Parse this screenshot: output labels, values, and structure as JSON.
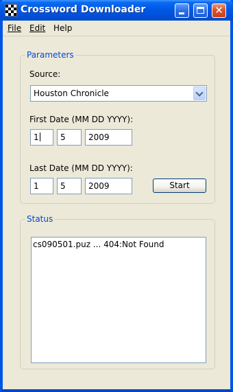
{
  "window": {
    "title": "Crossword Downloader"
  },
  "menu": {
    "file": "File",
    "edit": "Edit",
    "help": "Help"
  },
  "parameters": {
    "legend": "Parameters",
    "source_label": "Source:",
    "source_value": "Houston Chronicle",
    "first_date_label": "First Date (MM DD YYYY):",
    "first_date": {
      "month": "1",
      "day": "5",
      "year": "2009"
    },
    "last_date_label": "Last Date (MM DD YYYY):",
    "last_date": {
      "month": "1",
      "day": "5",
      "year": "2009"
    },
    "start_label": "Start"
  },
  "status": {
    "legend": "Status",
    "lines": [
      "cs090501.puz ... 404:Not Found"
    ]
  },
  "icons": {
    "app": "crossword-grid-icon",
    "minimize": "minimize-icon",
    "maximize": "maximize-icon",
    "close": "close-icon",
    "dropdown": "chevron-down-icon"
  },
  "colors": {
    "titlebar": "#0058e6",
    "window_bg": "#ece9d8",
    "legend_text": "#0046d5",
    "close_button": "#d9522e"
  }
}
